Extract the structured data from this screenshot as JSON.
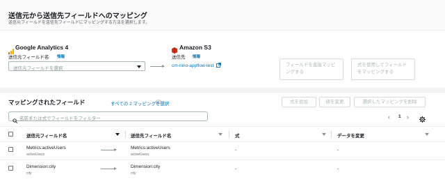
{
  "header": {
    "title": "送信元から送信先フィールドへのマッピング",
    "subtitle": "送信元フィールドを送信先フィールドにマッピングする方法を選択します。"
  },
  "source": {
    "name": "Google Analytics 4",
    "field_label": "送信元フィールド名",
    "info": "情報",
    "placeholder": "送信元フィールドを選択"
  },
  "destination": {
    "name": "Amazon S3",
    "dest_label": "送信先",
    "info": "情報",
    "bucket_link": "cm-nino-appflow-test"
  },
  "buttons": {
    "map_directly": "フィールドを直接マッピングする",
    "map_formula": "式を使用してフィールドをマッピングする"
  },
  "mapped": {
    "title": "マッピングされたフィールド",
    "select_all": "すべての 2 マッピングを選択",
    "count": "(2)",
    "add_formula": "式を追加",
    "change_value": "値を変更",
    "remove_selected": "選択したマッピングを削除",
    "filter_placeholder": "名前または式でフィールドをフィルター",
    "page": "1",
    "columns": [
      "送信元フィールド名",
      "送信先フィールド名",
      "式",
      "データを変更"
    ],
    "rows": [
      {
        "source_main": "Metrics:activeUsers",
        "source_sub": "activeUsers",
        "dest_main": "Metrics:activeUsers",
        "dest_sub": "activeUsers",
        "formula": "-",
        "modify": "-"
      },
      {
        "source_main": "Dimension:city",
        "source_sub": "city",
        "dest_main": "Dimension:city",
        "dest_sub": "city",
        "formula": "-",
        "modify": "-"
      }
    ]
  },
  "colors": {
    "link": "#0073bb",
    "s3_red": "#d13212",
    "ga_orange": "#f9ab00"
  },
  "icons": [
    "google-analytics-icon",
    "amazon-s3-icon",
    "external-link-icon",
    "search-icon",
    "settings-icon",
    "chevron-left-icon",
    "chevron-right-icon"
  ]
}
